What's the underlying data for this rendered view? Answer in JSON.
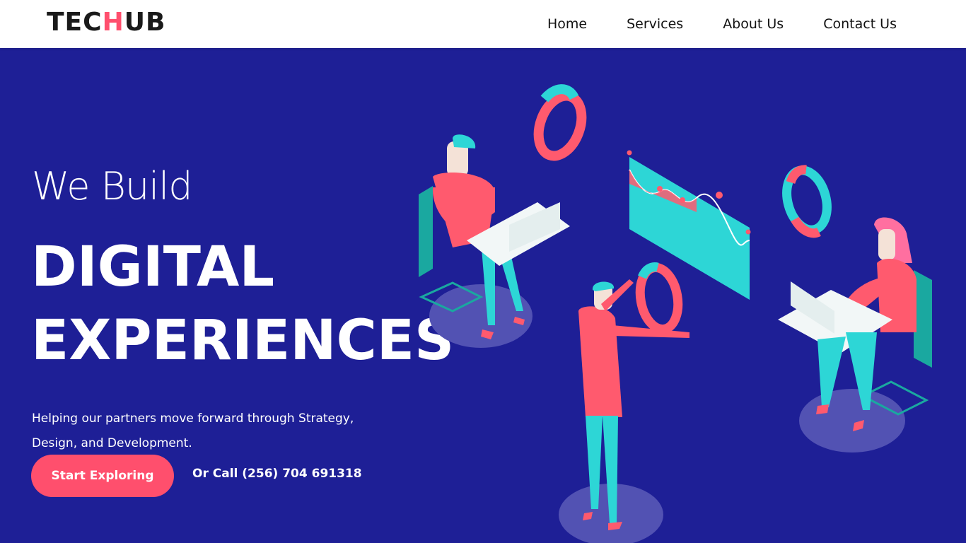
{
  "brand": {
    "prefix": "TEC",
    "accent": "H",
    "suffix": "UB",
    "accent_color": "#ff4f6d"
  },
  "nav": {
    "items": [
      {
        "label": "Home"
      },
      {
        "label": "Services"
      },
      {
        "label": "About Us"
      },
      {
        "label": "Contact Us"
      }
    ]
  },
  "hero": {
    "kicker": "We Build",
    "headline_line1": "DIGITAL",
    "headline_line2": "EXPERIENCES",
    "subtext": "Helping our partners move forward through Strategy, Design, and Development.",
    "cta_label": "Start Exploring",
    "call_text": "Or Call (256) 704 691318",
    "background_color": "#1e1f96"
  },
  "illustration": {
    "icons": [
      "donut-chart-icon",
      "line-chart-icon",
      "person-at-laptop-icon",
      "person-holding-chart-icon",
      "woman-at-laptop-icon"
    ]
  }
}
